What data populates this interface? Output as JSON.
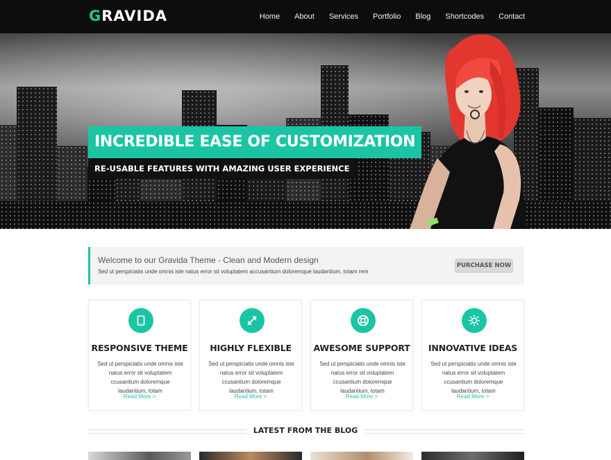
{
  "header": {
    "logo_first": "G",
    "logo_rest": "RAVIDA",
    "nav": [
      "Home",
      "About",
      "Services",
      "Portfolio",
      "Blog",
      "Shortcodes",
      "Contact"
    ]
  },
  "hero": {
    "title": "INCREDIBLE EASE OF CUSTOMIZATION",
    "subtitle": "RE-USABLE FEATURES WITH AMAZING USER EXPERIENCE"
  },
  "welcome": {
    "heading": "Welcome to our Gravida Theme - Clean and Modern design",
    "text": "Sed ut perspiciatis unde omnis iste natus error sit voluptatem accusantium doloremque laudantium, totam rem",
    "button": "PURCHASE NOW"
  },
  "features": [
    {
      "icon": "tablet-icon",
      "title": "RESPONSIVE THEME",
      "text": "Sed ut perspiciatis unde omnis iste natus error sit voluptatem ccusantium doloremque laudantium, totam",
      "link": "Read More >"
    },
    {
      "icon": "expand-arrows-icon",
      "title": "HIGHLY FLEXIBLE",
      "text": "Sed ut perspiciatis unde omnis iste natus error sit voluptatem ccusantium doloremque laudantium, totam",
      "link": "Read More >"
    },
    {
      "icon": "lifebuoy-icon",
      "title": "AWESOME SUPPORT",
      "text": "Sed ut perspiciatis unde omnis iste natus error sit voluptatem ccusantium doloremque laudantium, totam",
      "link": "Read More >"
    },
    {
      "icon": "sun-icon",
      "title": "INNOVATIVE IDEAS",
      "text": "Sed ut perspiciatis unde omnis iste natus error sit voluptatem ccusantium doloremque laudantium, totam",
      "link": "Read More >"
    }
  ],
  "blog": {
    "heading": "LATEST FROM THE BLOG"
  },
  "colors": {
    "accent": "#1bc5a4",
    "header_bg": "#0d0d0d"
  }
}
